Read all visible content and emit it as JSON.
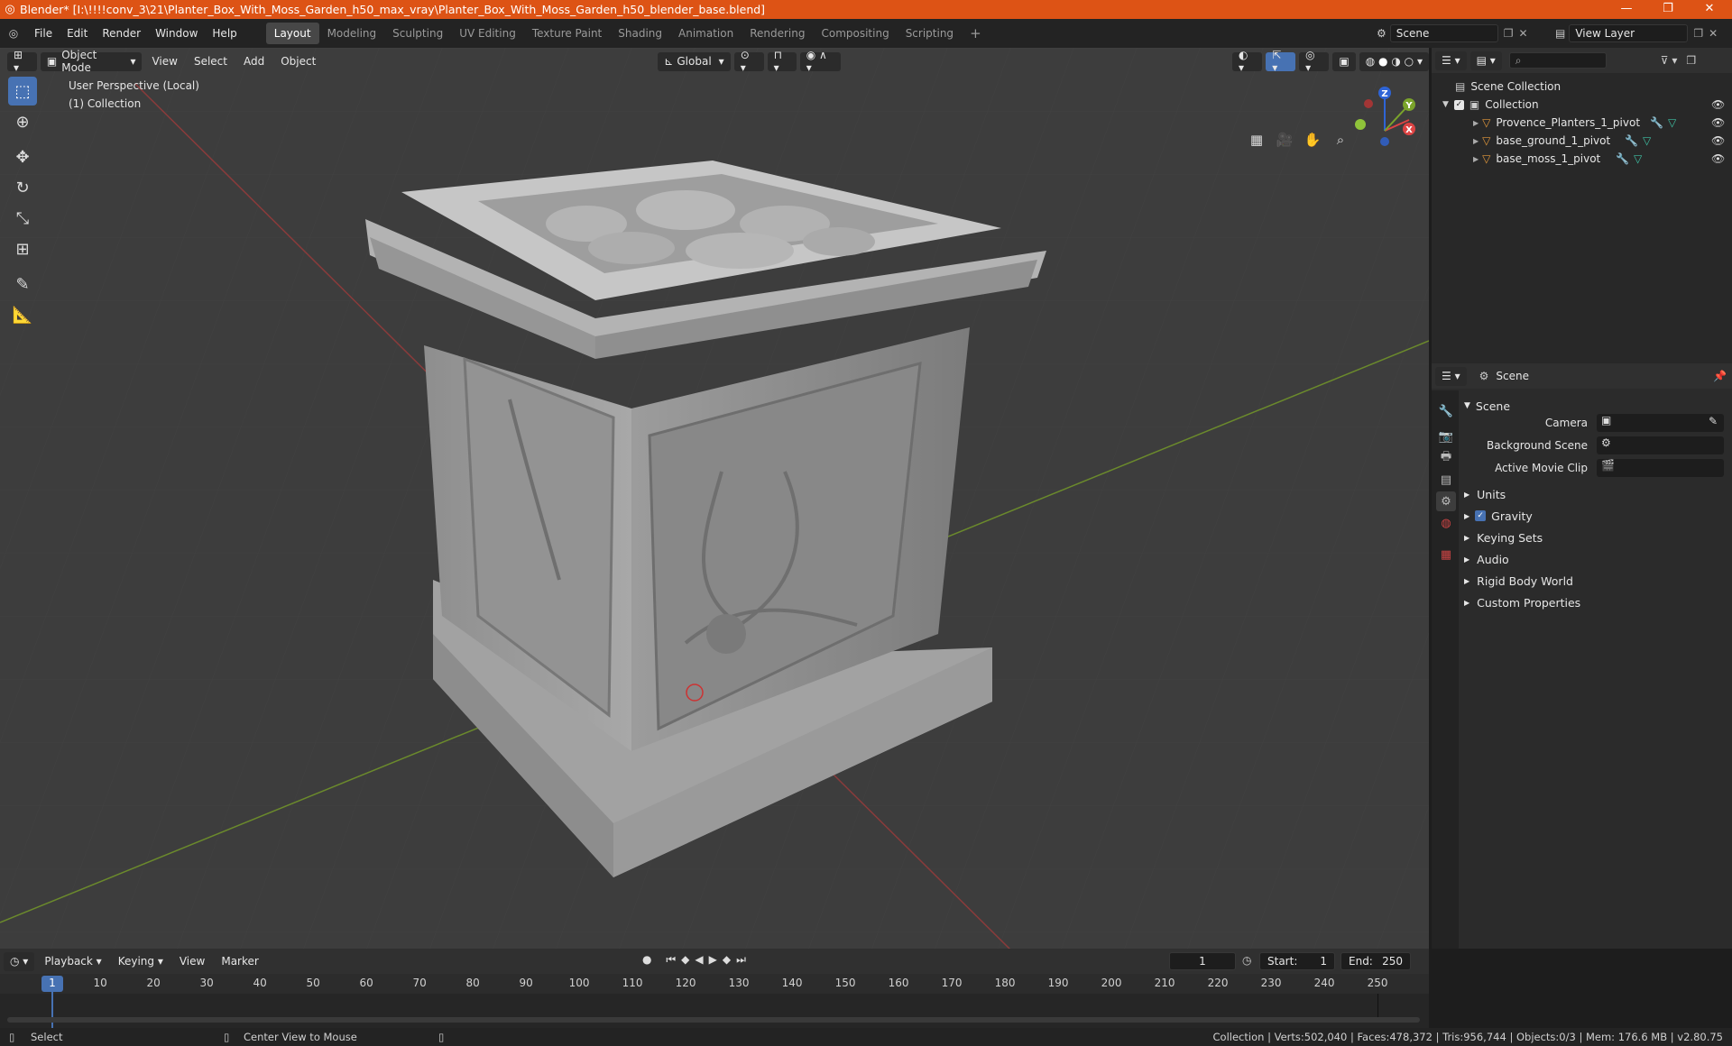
{
  "title_bar": {
    "title": "Blender* [I:\\!!!!conv_3\\21\\Planter_Box_With_Moss_Garden_h50_max_vray\\Planter_Box_With_Moss_Garden_h50_blender_base.blend]",
    "bg_color": "#dd5315"
  },
  "menu": {
    "items": [
      "File",
      "Edit",
      "Render",
      "Window",
      "Help"
    ]
  },
  "workspaces": [
    "Layout",
    "Modeling",
    "Sculpting",
    "UV Editing",
    "Texture Paint",
    "Shading",
    "Animation",
    "Rendering",
    "Compositing",
    "Scripting"
  ],
  "active_workspace": "Layout",
  "scene_field": "Scene",
  "view_layer_field": "View Layer",
  "viewport": {
    "mode": "Object Mode",
    "menus": [
      "View",
      "Select",
      "Add",
      "Object"
    ],
    "orientation": "Global",
    "overlay_line1": "User Perspective (Local)",
    "overlay_line2": "(1) Collection",
    "gizmo_axes": [
      "Z",
      "Y",
      "X"
    ]
  },
  "outliner": {
    "root": "Scene Collection",
    "collection": "Collection",
    "objects": [
      "Provence_Planters_1_pivot",
      "base_ground_1_pivot",
      "base_moss_1_pivot"
    ]
  },
  "properties": {
    "header": "Scene",
    "section": "Scene",
    "fields": [
      "Camera",
      "Background Scene",
      "Active Movie Clip"
    ],
    "subsections": [
      "Units",
      "Gravity",
      "Keying Sets",
      "Audio",
      "Rigid Body World",
      "Custom Properties"
    ],
    "gravity_checked": true
  },
  "timeline": {
    "menus": [
      "Playback",
      "Keying",
      "View",
      "Marker"
    ],
    "current_frame": "1",
    "start_label": "Start:",
    "start": "1",
    "end_label": "End:",
    "end": "250",
    "ticks": [
      "1",
      "10",
      "20",
      "30",
      "40",
      "50",
      "60",
      "70",
      "80",
      "90",
      "100",
      "110",
      "120",
      "130",
      "140",
      "150",
      "160",
      "170",
      "180",
      "190",
      "200",
      "210",
      "220",
      "230",
      "240",
      "250"
    ]
  },
  "status_bar": {
    "left_hint": "Select",
    "middle_hint": "Center View to Mouse",
    "right_info": "Collection | Verts:502,040 | Faces:478,372 | Tris:956,744 | Objects:0/3 | Mem: 176.6 MB | v2.80.75"
  }
}
